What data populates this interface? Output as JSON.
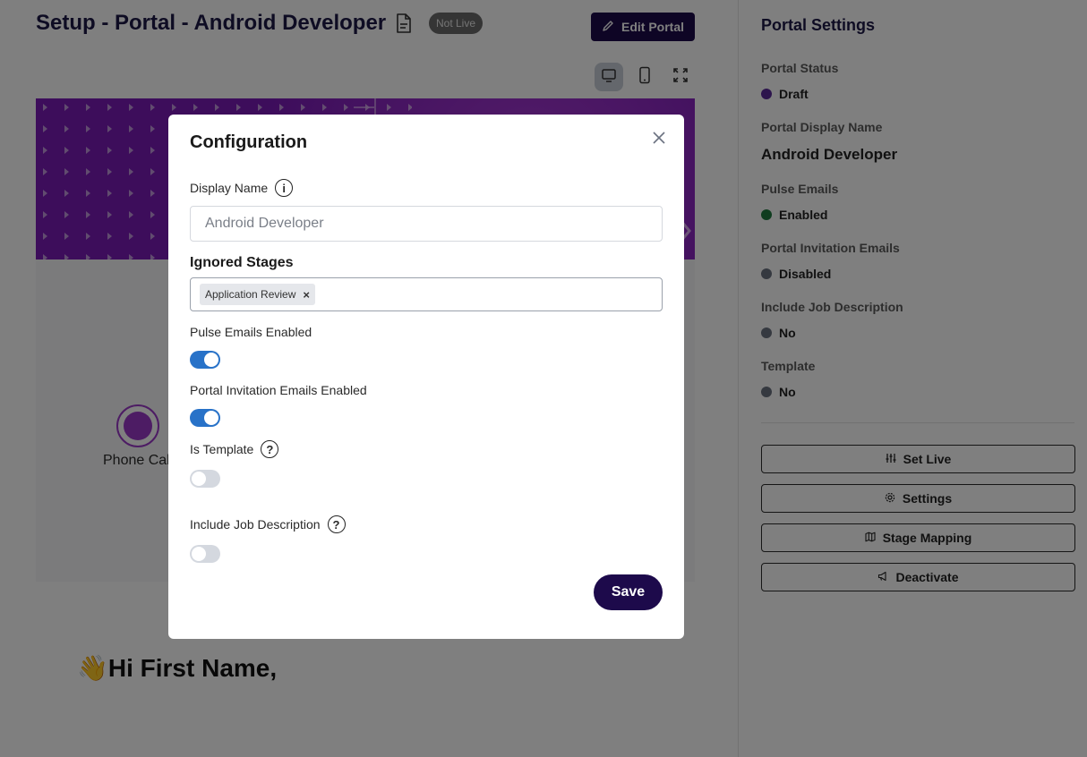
{
  "header": {
    "title": "Setup - Portal - Android Developer",
    "status_badge": "Not Live",
    "edit_button": "Edit Portal",
    "view_modes": [
      "desktop-icon",
      "mobile-icon",
      "fullscreen-icon"
    ]
  },
  "preview": {
    "stage_label": "Phone Cal",
    "greeting_emoji": "👋",
    "greeting": "Hi First Name,"
  },
  "sidebar": {
    "title": "Portal Settings",
    "settings": [
      {
        "label": "Portal Status",
        "value": "Draft",
        "dot_color": "#5b2a9a"
      },
      {
        "label": "Portal Display Name",
        "value": "Android Developer"
      },
      {
        "label": "Pulse Emails",
        "value": "Enabled",
        "dot_color": "#1f7a3e"
      },
      {
        "label": "Portal Invitation Emails",
        "value": "Disabled",
        "dot_color": "#6b7280"
      },
      {
        "label": "Include Job Description",
        "value": "No",
        "dot_color": "#6b7280"
      },
      {
        "label": "Template",
        "value": "No",
        "dot_color": "#6b7280"
      }
    ],
    "buttons": [
      {
        "label": "Set Live",
        "icon": "sliders-icon"
      },
      {
        "label": "Settings",
        "icon": "gear-icon"
      },
      {
        "label": "Stage Mapping",
        "icon": "map-icon"
      },
      {
        "label": "Deactivate",
        "icon": "megaphone-icon"
      }
    ]
  },
  "modal": {
    "title": "Configuration",
    "display_name_label": "Display Name",
    "display_name_value": "Android Developer",
    "ignored_stages_label": "Ignored Stages",
    "ignored_stages": [
      "Application Review"
    ],
    "tag_remove": "×",
    "pulse_label": "Pulse Emails Enabled",
    "pulse_enabled": true,
    "invitation_label": "Portal Invitation Emails Enabled",
    "invitation_enabled": true,
    "template_label": "Is Template",
    "template_enabled": false,
    "job_desc_label": "Include Job Description",
    "job_desc_enabled": false,
    "save_label": "Save"
  }
}
